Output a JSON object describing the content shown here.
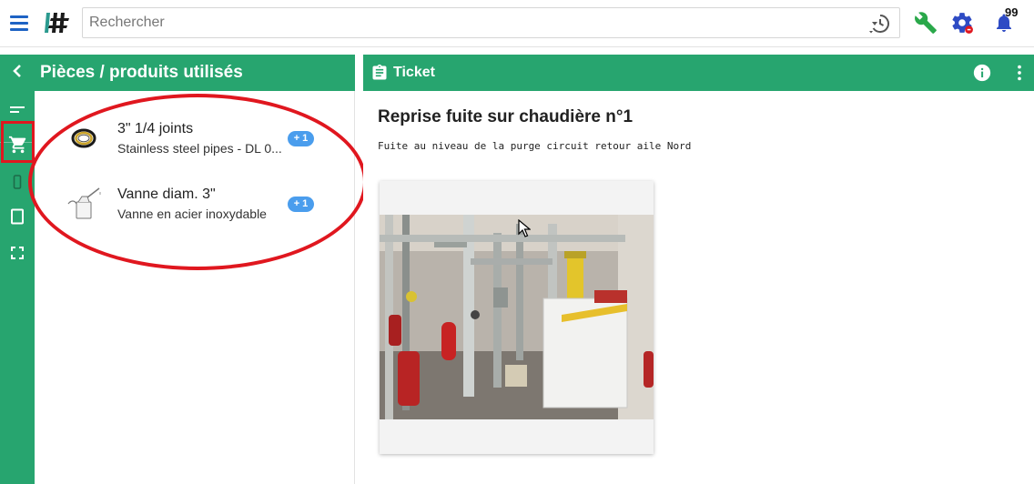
{
  "topbar": {
    "search_placeholder": "Rechercher",
    "notification_count": "99",
    "icons": [
      "menu-icon",
      "app-logo",
      "history-icon",
      "wrench-icon",
      "settings-gear-icon",
      "bell-icon"
    ],
    "colors": {
      "menu": "#1e63c4",
      "wrench": "#2aa84a",
      "gear": "#2e4bc4",
      "bell": "#2e4bc4"
    }
  },
  "rail": {
    "items": [
      "collapse-chevron-icon",
      "notes-lines-icon",
      "cart-icon",
      "phone-icon",
      "tablet-icon",
      "fullscreen-icon"
    ],
    "active": "cart-icon"
  },
  "parts": {
    "title": "Pièces / produits utilisés",
    "items": [
      {
        "name": "3\" 1/4 joints",
        "description": "Stainless steel pipes - DL 0...",
        "quantity": "+ 1",
        "thumb_icon": "gasket-ring-icon"
      },
      {
        "name": "Vanne diam. 3\"",
        "description": "Vanne en acier inoxydable",
        "quantity": "+ 1",
        "thumb_icon": "oil-can-icon"
      }
    ]
  },
  "ticket": {
    "header_title": "Ticket",
    "subject": "Reprise fuite sur chaudière n°1",
    "description": "Fuite au niveau de la purge circuit retour aile Nord",
    "photo": "boiler-room-photo"
  },
  "theme": {
    "green": "#27a56f",
    "badge": "#4a9ded",
    "annotation": "#e0171f"
  }
}
